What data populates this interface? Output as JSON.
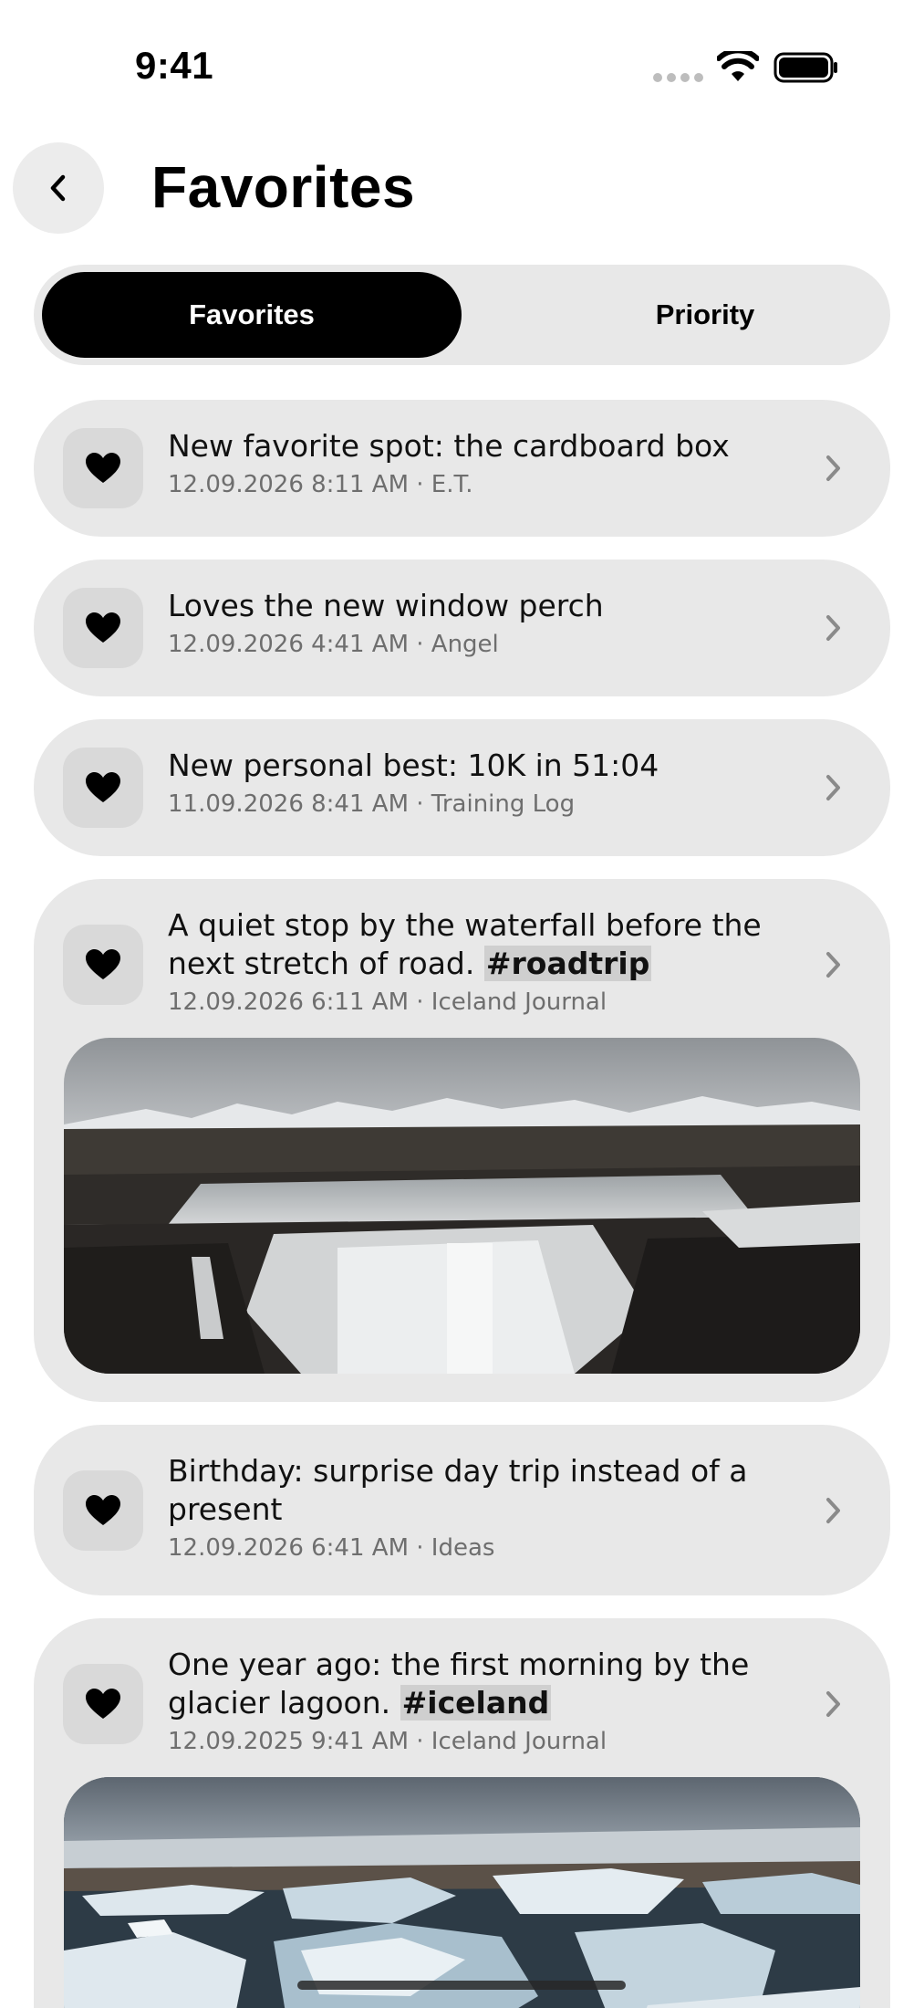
{
  "status": {
    "time": "9:41"
  },
  "header": {
    "title": "Favorites"
  },
  "tabs": [
    {
      "label": "Favorites",
      "active": true
    },
    {
      "label": "Priority",
      "active": false
    }
  ],
  "entries": [
    {
      "title": "New favorite spot: the cardboard box",
      "date": "12.09.2026 8:11 AM",
      "source": "E.T.",
      "meta": "12.09.2026 8:11 AM · E.T."
    },
    {
      "title": "Loves the new window perch",
      "date": "12.09.2026 4:41 AM",
      "source": "Angel",
      "meta": "12.09.2026 4:41 AM · Angel"
    },
    {
      "title": "New personal best: 10K in 51:04",
      "date": "11.09.2026 8:41 AM",
      "source": "Training Log",
      "meta": "11.09.2026 8:41 AM · Training Log"
    },
    {
      "title": "A quiet stop by the waterfall before the next stretch of road.",
      "hashtag": "#roadtrip",
      "date": "12.09.2026 6:11 AM",
      "source": "Iceland Journal",
      "meta": "12.09.2026 6:11 AM · Iceland Journal",
      "photo": "waterfall"
    },
    {
      "title": "Birthday: surprise day trip instead of a present",
      "date": "12.09.2026 6:41 AM",
      "source": "Ideas",
      "meta": "12.09.2026 6:41 AM · Ideas"
    },
    {
      "title": "One year ago: the first morning by the glacier lagoon.",
      "hashtag": "#iceland",
      "date": "12.09.2025 9:41 AM",
      "source": "Iceland Journal",
      "meta": "12.09.2025 9:41 AM · Iceland Journal",
      "photo": "glacier-lagoon"
    }
  ],
  "icons": {
    "back": "chevron-left-icon",
    "favorite": "heart-icon",
    "open": "chevron-right-icon"
  },
  "colors": {
    "card_bg": "#e8e8e8",
    "icon_tile": "#d9d9d9",
    "active_tab": "#000000",
    "meta_text": "#6e6e6e",
    "hashtag_bg": "#cfcfcf"
  }
}
